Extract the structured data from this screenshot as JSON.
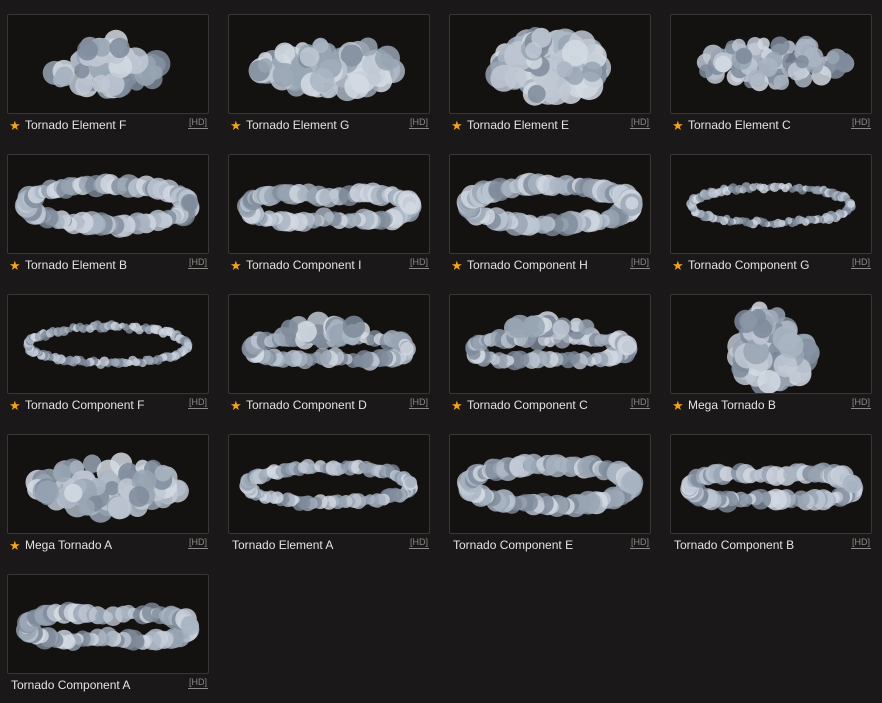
{
  "hd_label": "HD",
  "colors": {
    "background": "#1a1818",
    "thumbnail_bg": "#141211",
    "star": "#f3a21b",
    "cloud": "#a9b4c3"
  },
  "items": [
    {
      "name": "Tornado Element F",
      "starred": true,
      "shape": "blob-puffy"
    },
    {
      "name": "Tornado Element G",
      "starred": true,
      "shape": "blob-wide"
    },
    {
      "name": "Tornado Element E",
      "starred": true,
      "shape": "blob-tall"
    },
    {
      "name": "Tornado Element C",
      "starred": true,
      "shape": "blob-flat"
    },
    {
      "name": "Tornado Element B",
      "starred": true,
      "shape": "ring-thick"
    },
    {
      "name": "Tornado Component I",
      "starred": true,
      "shape": "ring-twist"
    },
    {
      "name": "Tornado Component H",
      "starred": true,
      "shape": "ring-thick"
    },
    {
      "name": "Tornado Component G",
      "starred": true,
      "shape": "ring-thin"
    },
    {
      "name": "Tornado Component F",
      "starred": true,
      "shape": "ring-thin"
    },
    {
      "name": "Tornado Component D",
      "starred": true,
      "shape": "ring-puffy"
    },
    {
      "name": "Tornado Component C",
      "starred": true,
      "shape": "ring-puffy"
    },
    {
      "name": "Mega Tornado B",
      "starred": true,
      "shape": "column"
    },
    {
      "name": "Mega Tornado A",
      "starred": true,
      "shape": "blob-wide"
    },
    {
      "name": "Tornado Element A",
      "starred": false,
      "shape": "ring-medium"
    },
    {
      "name": "Tornado Component E",
      "starred": false,
      "shape": "ring-thick"
    },
    {
      "name": "Tornado Component B",
      "starred": false,
      "shape": "ring-twist"
    },
    {
      "name": "Tornado Component A",
      "starred": false,
      "shape": "ring-twist"
    }
  ]
}
